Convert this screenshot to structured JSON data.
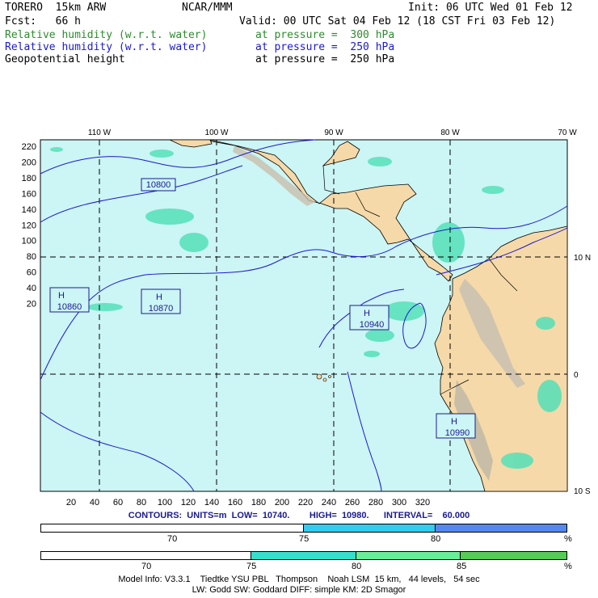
{
  "header": {
    "left1": "TORERO  15km ARW",
    "center1": "NCAR/MMM",
    "right1": "Init: 06 UTC Wed 01 Feb 12",
    "left2": "Fcst:   66 h",
    "right2": "Valid: 00 UTC Sat 04 Feb 12 (18 CST Fri 03 Feb 12)",
    "fields": [
      {
        "name": "Relative humidity (w.r.t. water)",
        "level": "at pressure =  300 hPa",
        "color": "#2e8b2e"
      },
      {
        "name": "Relative humidity (w.r.t. water)",
        "level": "at pressure =  250 hPa",
        "color": "#1a1ad0"
      },
      {
        "name": "Geopotential height",
        "level": "at pressure =  250 hPa",
        "color": "#000000"
      }
    ]
  },
  "map": {
    "lon_labels": [
      "110 W",
      "100 W",
      "90 W",
      "80 W",
      "70 W"
    ],
    "lat_labels": [
      "10 N",
      "0",
      "10 S"
    ],
    "y_ticks": [
      "220",
      "200",
      "180",
      "160",
      "140",
      "120",
      "100",
      "80",
      "60",
      "40",
      "20"
    ],
    "x_ticks": [
      "20",
      "40",
      "60",
      "80",
      "100",
      "120",
      "140",
      "160",
      "180",
      "200",
      "220",
      "240",
      "260",
      "280",
      "300",
      "320"
    ],
    "contour_labels": [
      "10800"
    ],
    "highs": [
      {
        "symbol": "H",
        "value": "10860"
      },
      {
        "symbol": "H",
        "value": "10870"
      },
      {
        "symbol": "H",
        "value": "10940"
      },
      {
        "symbol": "H",
        "value": "10990"
      }
    ],
    "ocean_color": "#ccf5f5",
    "land_color": "#f5d9a8"
  },
  "contour_info": "CONTOURS:  UNITS=m  LOW=  10740.        HIGH=  10980.      INTERVAL=    60.000",
  "bar1": {
    "ticks": [
      "70",
      "75",
      "80",
      "%"
    ],
    "colors": [
      "#ffffff",
      "#33ccee",
      "#5588ee"
    ]
  },
  "bar2": {
    "ticks": [
      "70",
      "75",
      "80",
      "85",
      "%"
    ],
    "colors": [
      "#ffffff",
      "#33e0cc",
      "#66ee99",
      "#55cc55"
    ]
  },
  "footer": {
    "line1": "Model Info: V3.3.1    Tiedtke YSU PBL   Thompson    Noah LSM  15 km,   44 levels,   54 sec",
    "line2": "LW: Godd SW: Goddard DIFF: simple KM: 2D Smagor"
  }
}
